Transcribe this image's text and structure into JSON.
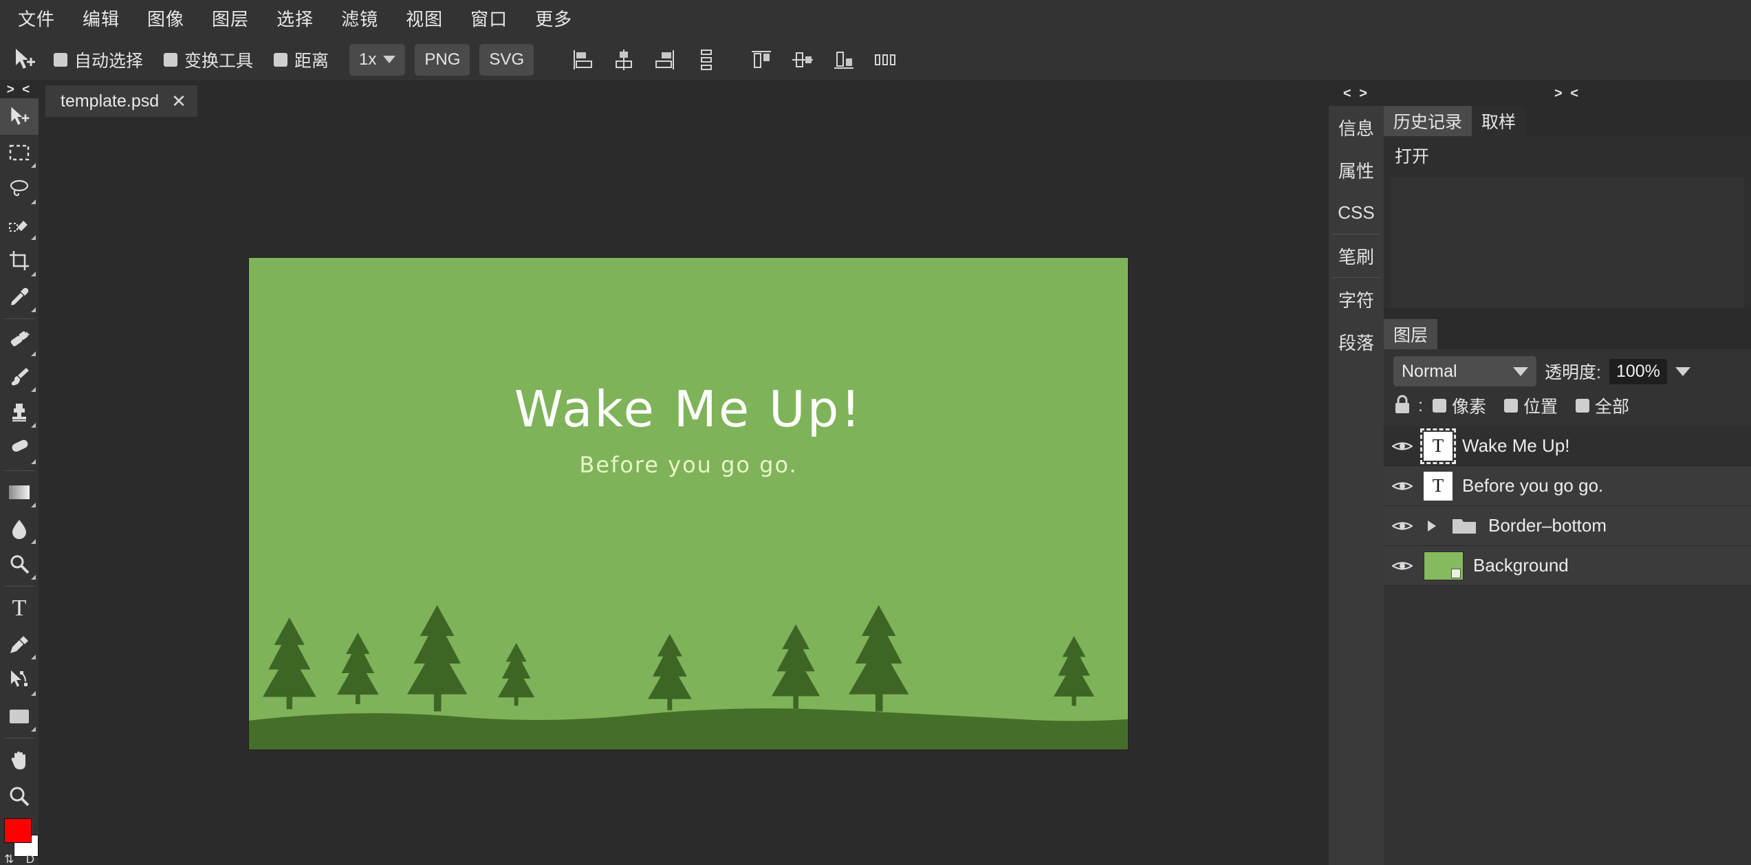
{
  "menubar": {
    "items": [
      {
        "label": "文件",
        "name": "menu-file"
      },
      {
        "label": "编辑",
        "name": "menu-edit"
      },
      {
        "label": "图像",
        "name": "menu-image"
      },
      {
        "label": "图层",
        "name": "menu-layer"
      },
      {
        "label": "选择",
        "name": "menu-select"
      },
      {
        "label": "滤镜",
        "name": "menu-filter"
      },
      {
        "label": "视图",
        "name": "menu-view"
      },
      {
        "label": "窗口",
        "name": "menu-window"
      },
      {
        "label": "更多",
        "name": "menu-more"
      }
    ]
  },
  "optionsbar": {
    "tool_icon": "move-tool-icon",
    "checkboxes": [
      {
        "label": "自动选择",
        "checked": true
      },
      {
        "label": "变换工具",
        "checked": true
      },
      {
        "label": "距离",
        "checked": true
      }
    ],
    "scale_label": "1x",
    "png_label": "PNG",
    "svg_label": "SVG",
    "align_icons": [
      "align-left-icon",
      "align-center-horizontal-icon",
      "align-right-icon",
      "distribute-vertical-icon",
      "align-top-icon",
      "align-middle-vertical-icon",
      "align-bottom-icon",
      "distribute-horizontal-icon"
    ]
  },
  "toolbar": {
    "collapse_glyph": "> <",
    "tools": [
      {
        "name": "move-tool",
        "active": true
      },
      {
        "name": "rectangular-marquee-tool",
        "active": false
      },
      {
        "name": "lasso-tool",
        "active": false
      },
      {
        "name": "quick-selection-tool",
        "active": false
      },
      {
        "name": "crop-tool",
        "active": false
      },
      {
        "name": "eyedropper-tool",
        "active": false
      },
      {
        "name": "healing-brush-tool",
        "active": false
      },
      {
        "name": "brush-tool",
        "active": false
      },
      {
        "name": "clone-stamp-tool",
        "active": false
      },
      {
        "name": "eraser-tool",
        "active": false
      },
      {
        "name": "gradient-tool",
        "active": false
      },
      {
        "name": "blur-tool",
        "active": false
      },
      {
        "name": "dodge-tool",
        "active": false
      },
      {
        "name": "type-tool",
        "active": false
      },
      {
        "name": "pen-tool",
        "active": false
      },
      {
        "name": "path-selection-tool",
        "active": false
      },
      {
        "name": "rectangle-shape-tool",
        "active": false
      },
      {
        "name": "hand-tool",
        "active": false
      },
      {
        "name": "zoom-tool",
        "active": false
      }
    ],
    "foreground_color": "#ff0000",
    "background_color": "#ffffff",
    "swap_glyph": "⇅",
    "default_glyph": "D"
  },
  "document": {
    "tab_name": "template.psd",
    "close_glyph": "✕"
  },
  "canvas": {
    "background_color": "#7fb359",
    "hill_color": "#456f28",
    "tree_color": "#3d6625",
    "title": "Wake Me Up!",
    "title_color": "#ffffff",
    "subtitle": "Before you go go.",
    "subtitle_color": "#e8f5c8"
  },
  "vertical_rail": {
    "collapse_glyph": "< >",
    "groups": [
      [
        "信息",
        "属性",
        "CSS"
      ],
      [
        "笔刷"
      ],
      [
        "字符",
        "段落"
      ]
    ]
  },
  "right_panel": {
    "collapse_glyph": "> <",
    "history": {
      "tabs": [
        {
          "label": "历史记录",
          "active": true
        },
        {
          "label": "取样",
          "active": false
        }
      ],
      "entries": [
        "打开"
      ]
    },
    "layers": {
      "tab_label": "图层",
      "blend_mode": "Normal",
      "opacity_label": "透明度:",
      "opacity_value": "100%",
      "lock_icon": "lock-icon",
      "lock_colon": ":",
      "lock_options": [
        {
          "label": "像素",
          "checked": true
        },
        {
          "label": "位置",
          "checked": true
        },
        {
          "label": "全部",
          "checked": true
        }
      ],
      "rows": [
        {
          "name": "Wake Me Up!",
          "type": "text",
          "selected": true,
          "visible": true,
          "expandable": false
        },
        {
          "name": "Before you go go.",
          "type": "text",
          "selected": false,
          "visible": true,
          "expandable": false
        },
        {
          "name": "Border–bottom",
          "type": "group",
          "selected": false,
          "visible": true,
          "expandable": true
        },
        {
          "name": "Background",
          "type": "image",
          "selected": false,
          "visible": true,
          "expandable": false
        }
      ]
    }
  }
}
